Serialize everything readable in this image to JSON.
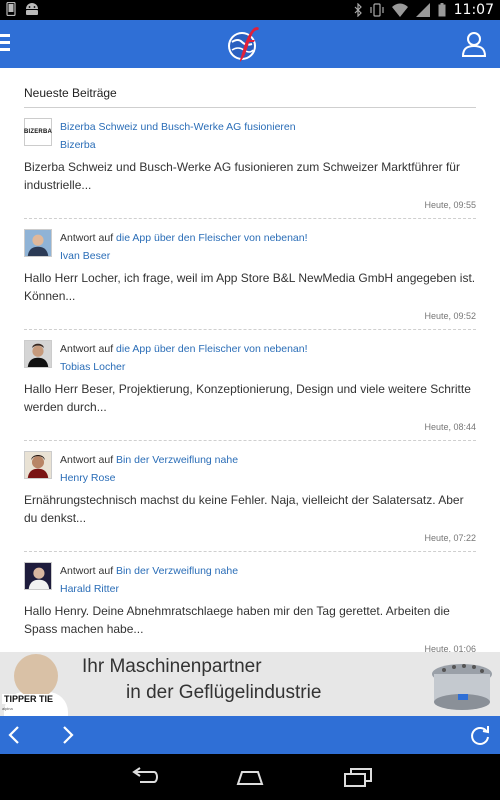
{
  "status_bar": {
    "time": "11:07",
    "left_icons": [
      "phone-icon",
      "android-icon"
    ],
    "right_icons": [
      "bluetooth-icon",
      "vibrate-icon",
      "wifi-icon",
      "signal-icon",
      "battery-icon"
    ]
  },
  "app_bar": {
    "icons": [
      "menu-icon",
      "app-logo-icon",
      "user-icon"
    ],
    "color": "#2f6fd6"
  },
  "section": {
    "title": "Neueste Beiträge"
  },
  "posts": [
    {
      "avatar": "bizerba-logo",
      "avatar_text": "BIZERBA",
      "prefix": "",
      "topic": "Bizerba Schweiz und Busch-Werke AG fusionieren",
      "author": "Bizerba",
      "text": "Bizerba Schweiz und Busch-Werke AG fusionieren zum Schweizer Marktführer für industrielle...",
      "time": "Heute, 09:55"
    },
    {
      "avatar": "avatar-ivan-beser",
      "prefix": "Antwort auf",
      "topic": "die App über den Fleischer von nebenan!",
      "author": "Ivan Beser",
      "text": "Hallo Herr Locher, ich frage, weil im App Store B&L NewMedia GmbH angegeben ist. Können...",
      "time": "Heute, 09:52"
    },
    {
      "avatar": "avatar-tobias-locher",
      "prefix": "Antwort auf",
      "topic": "die App über den Fleischer von nebenan!",
      "author": "Tobias Locher",
      "text": "Hallo Herr Beser, Projektierung, Konzeptionierung, Design und viele weitere Schritte werden durch...",
      "time": "Heute, 08:44"
    },
    {
      "avatar": "avatar-henry-rose",
      "prefix": "Antwort auf",
      "topic": "Bin der Verzweiflung nahe",
      "author": "Henry Rose",
      "text": "Ernährungstechnisch machst du keine Fehler. Naja, vielleicht der Salatersatz. Aber du denkst...",
      "time": "Heute, 07:22"
    },
    {
      "avatar": "avatar-harald-ritter",
      "prefix": "Antwort auf",
      "topic": "Bin der Verzweiflung nahe",
      "author": "Harald Ritter",
      "text": "Hallo Henry. Deine Abnehmratschlaege haben mir den Tag gerettet. Arbeiten die Spass machen habe...",
      "time": "Heute, 01:06"
    }
  ],
  "ad": {
    "line1": "Ihr Maschinenpartner",
    "line2": "in der Geflügelindustrie",
    "brand": "TIPPER TIE",
    "tagline": "alpina"
  },
  "bottom_bar": {
    "icons": [
      "back-arrow-icon",
      "forward-arrow-icon",
      "refresh-icon"
    ]
  },
  "system_nav": {
    "icons": [
      "system-back-icon",
      "system-home-icon",
      "system-recents-icon"
    ]
  }
}
